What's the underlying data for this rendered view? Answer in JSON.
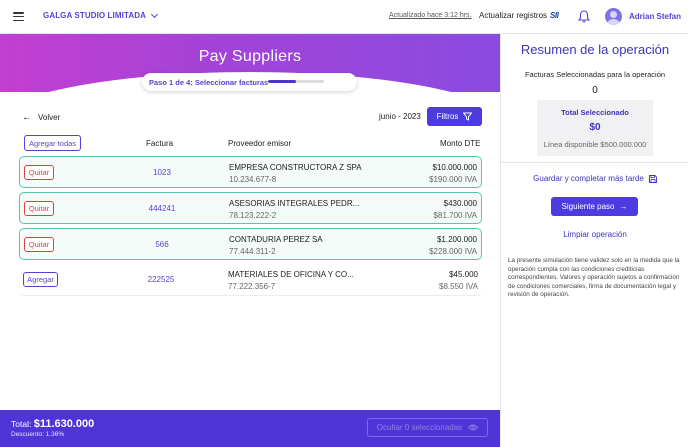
{
  "topbar": {
    "company": "GALGA STUDIO LIMITADA",
    "updated": "Actualizado hace 3:12 hrs.",
    "refresh_label": "Actualizar registros",
    "sii_logo": "SII",
    "user_name": "Adrian Stefan"
  },
  "hero": {
    "title": "Pay Suppliers",
    "step_label": "Paso 1 de 4: Seleccionar facturas",
    "step_progress": 0.5
  },
  "toolbar": {
    "back_label": "Volver",
    "period": "junio - 2023",
    "filters_label": "Filtros",
    "add_all_label": "Agregar todas"
  },
  "table": {
    "headers": {
      "invoice": "Factura",
      "supplier": "Proveedor emisor",
      "amount": "Monto DTE"
    },
    "rows": [
      {
        "action": "Quitar",
        "selected": true,
        "invoice": "1023",
        "supplier": "EMPRESA CONSTRUCTORA Z SPA",
        "rut": "10.234.677-8",
        "amount": "$10.000.000",
        "iva": "$190.000 IVA"
      },
      {
        "action": "Quitar",
        "selected": true,
        "invoice": "444241",
        "supplier": "ASESORIAS INTEGRALES PEDR...",
        "rut": "78.123.222-2",
        "amount": "$430.000",
        "iva": "$81.700 IVA"
      },
      {
        "action": "Quitar",
        "selected": true,
        "invoice": "566",
        "supplier": "CONTADURIA PEREZ SA",
        "rut": "77.444.311-2",
        "amount": "$1.200.000",
        "iva": "$228.000 IVA"
      },
      {
        "action": "Agregar",
        "selected": false,
        "invoice": "222525",
        "supplier": "MATERIALES DE OFICINA Y CO...",
        "rut": "77.222.356-7",
        "amount": "$45.000",
        "iva": "$8.550 IVA"
      }
    ]
  },
  "footer": {
    "total_label": "Total:",
    "total_value": "$11.630.000",
    "discount": "Descuento: 1.36%",
    "hide_label": "Ocultar 0 seleccionadas"
  },
  "sidebar": {
    "title": "Resumen de la operación",
    "selected_label": "Facturas Seleccionadas para la operación",
    "selected_count": "0",
    "total_selected_label": "Total Seleccionado",
    "total_selected_value": "$0",
    "available_line": "Línea disponible $500.000.000",
    "save_label": "Guardar y completar más tarde",
    "next_label": "Siguiente paso",
    "clear_label": "Limpiar operación",
    "disclaimer": "La presente simulación tiene validez solo en la medida que la operación cumpla con las condiciones crediticias correspondientes. Valores y operación sujetos a confirmación de condiciones comerciales, firma de documentación legal y revisión de operación."
  },
  "colors": {
    "accent": "#4d3ae0",
    "selected_border": "#56c7ae",
    "remove": "#d6443a"
  }
}
